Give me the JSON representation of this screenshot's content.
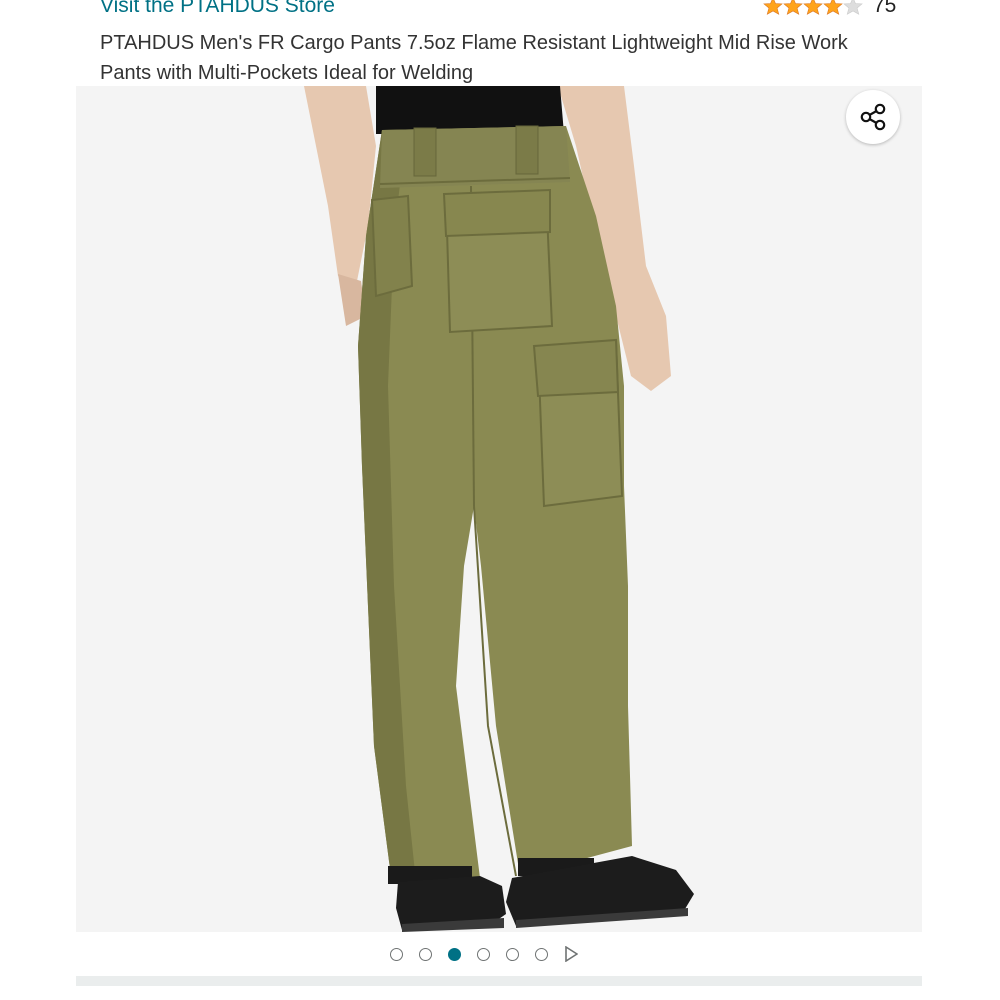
{
  "header": {
    "store_link": "Visit the PTAHDUS Store",
    "rating": {
      "stars": 4,
      "max_stars": 5,
      "count": "75",
      "star_color": "#ffa41c",
      "empty_star_color": "#dddddd"
    },
    "product_title": "PTAHDUS Men's FR Cargo Pants 7.5oz Flame Resistant Lightweight Mid Rise Work Pants with Multi-Pockets Ideal for Welding"
  },
  "gallery": {
    "share_icon": "share-icon",
    "image_alt_icon": "product-image",
    "dots_total": 6,
    "active_index": 2,
    "active_color": "#007185",
    "next_icon": "play-icon"
  }
}
